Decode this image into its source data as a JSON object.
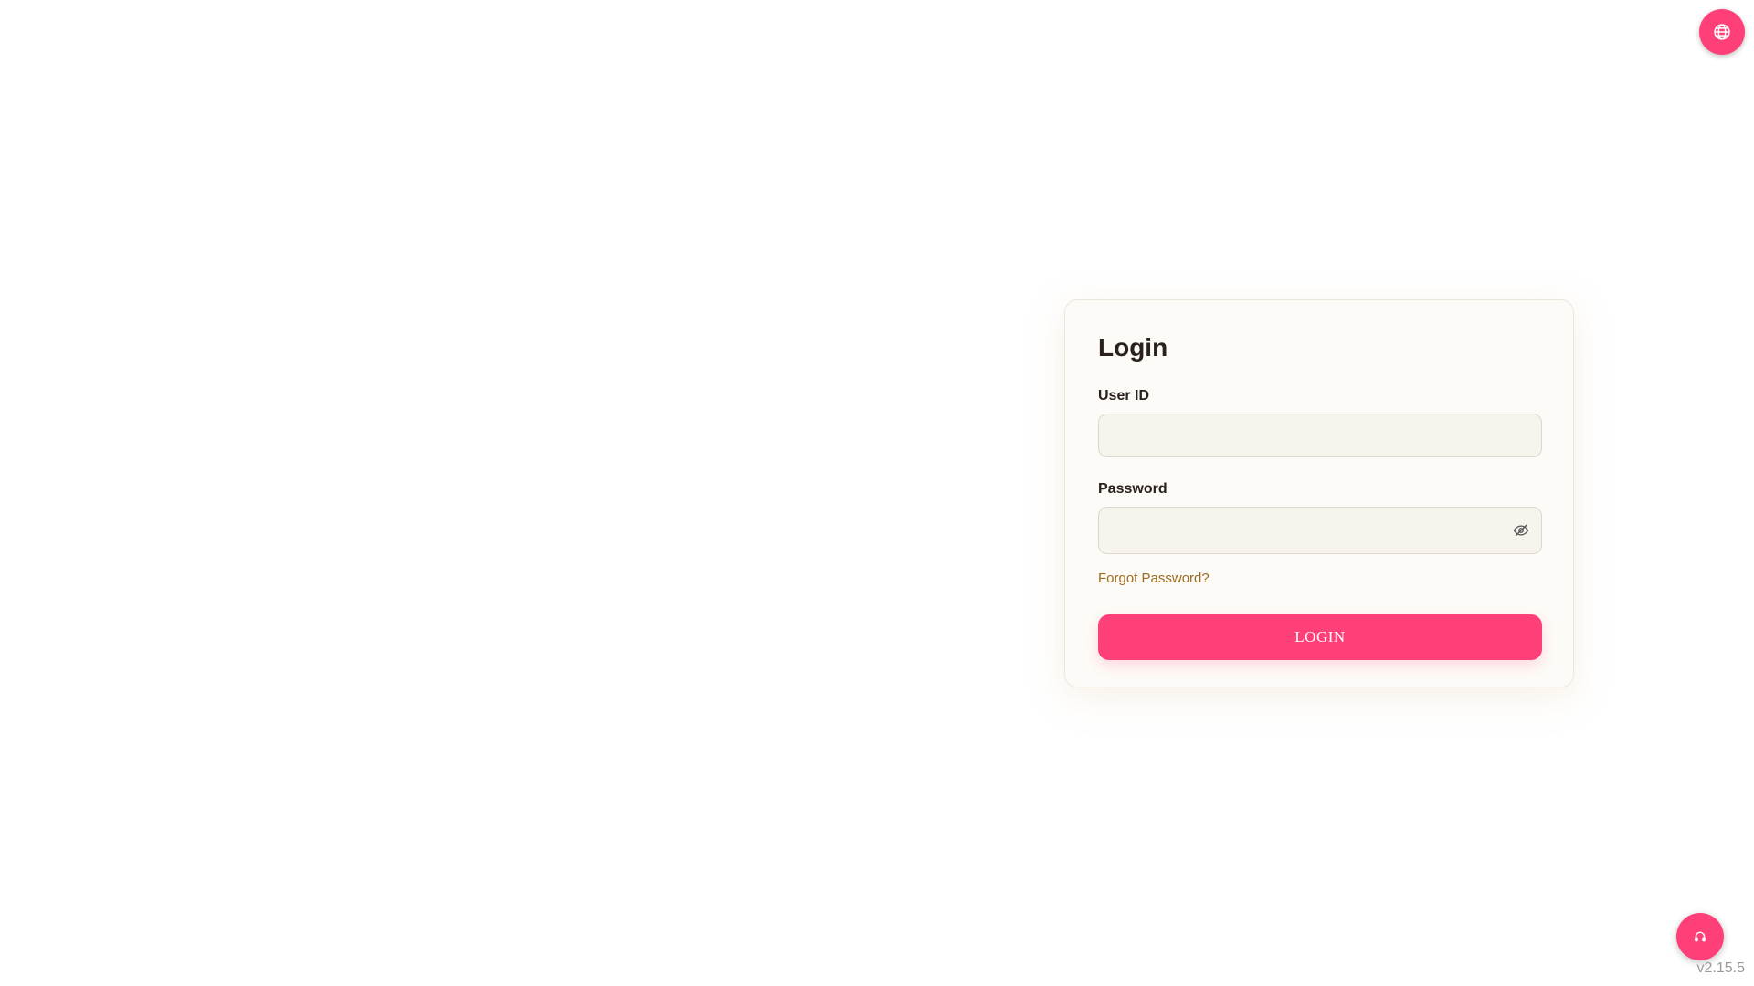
{
  "header": {
    "language_icon": "globe-icon"
  },
  "login": {
    "title": "Login",
    "user_id_label": "User ID",
    "user_id_value": "",
    "password_label": "Password",
    "password_value": "",
    "password_toggle_icon": "eye-slash-icon",
    "forgot_password": "Forgot Password?",
    "submit_label": "LOGIN"
  },
  "footer": {
    "support_icon": "headset-icon",
    "version": "v2.15.5"
  },
  "colors": {
    "accent": "#ff3f78",
    "card_background": "#fdfbf7",
    "input_background": "#f7f4ee",
    "link": "#9c6a1f",
    "text": "#2a211c"
  }
}
